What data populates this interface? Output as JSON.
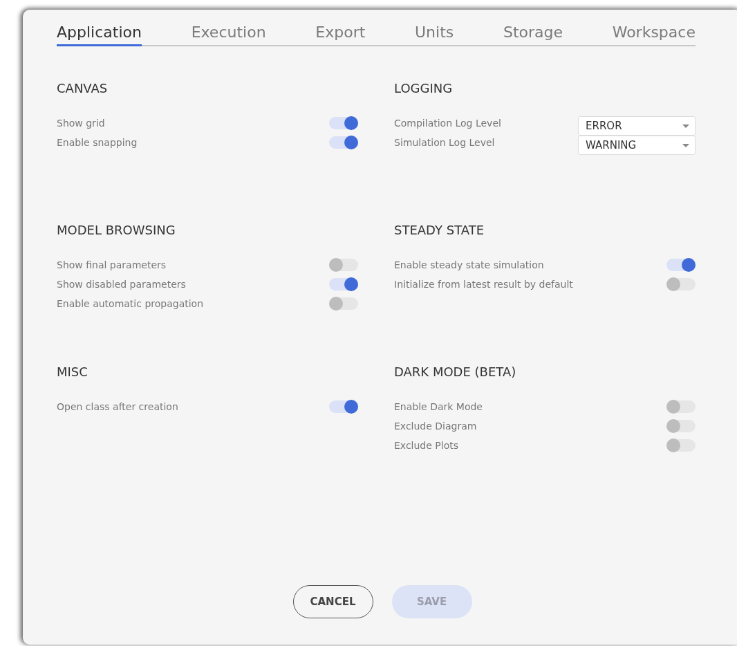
{
  "tabs": [
    {
      "label": "Application",
      "selected": true
    },
    {
      "label": "Execution",
      "selected": false
    },
    {
      "label": "Export",
      "selected": false
    },
    {
      "label": "Units",
      "selected": false
    },
    {
      "label": "Storage",
      "selected": false
    },
    {
      "label": "Workspace",
      "selected": false
    }
  ],
  "sections": [
    {
      "title": "CANVAS",
      "items": [
        {
          "kind": "toggle",
          "label": "Show grid",
          "on": true
        },
        {
          "kind": "toggle",
          "label": "Enable snapping",
          "on": true
        }
      ]
    },
    {
      "title": "LOGGING",
      "items": [
        {
          "kind": "select",
          "label": "Compilation Log Level",
          "value": "ERROR"
        },
        {
          "kind": "select",
          "label": "Simulation Log Level",
          "value": "WARNING"
        }
      ]
    },
    {
      "title": "MODEL BROWSING",
      "items": [
        {
          "kind": "toggle",
          "label": "Show final parameters",
          "on": false
        },
        {
          "kind": "toggle",
          "label": "Show disabled parameters",
          "on": true
        },
        {
          "kind": "toggle",
          "label": "Enable automatic propagation",
          "on": false
        }
      ]
    },
    {
      "title": "STEADY STATE",
      "items": [
        {
          "kind": "toggle",
          "label": "Enable steady state simulation",
          "on": true
        },
        {
          "kind": "toggle",
          "label": "Initialize from latest result by default",
          "on": false
        }
      ]
    },
    {
      "title": "MISC",
      "items": [
        {
          "kind": "toggle",
          "label": "Open class after creation",
          "on": true
        }
      ]
    },
    {
      "title": "DARK MODE (BETA)",
      "items": [
        {
          "kind": "toggle",
          "label": "Enable Dark Mode",
          "on": false
        },
        {
          "kind": "toggle",
          "label": "Exclude Diagram",
          "on": false
        },
        {
          "kind": "toggle",
          "label": "Exclude Plots",
          "on": false
        }
      ]
    }
  ],
  "buttons": [
    {
      "label": "CANCEL",
      "kind": "outline",
      "disabled": false
    },
    {
      "label": "SAVE",
      "kind": "primary",
      "disabled": true
    }
  ]
}
